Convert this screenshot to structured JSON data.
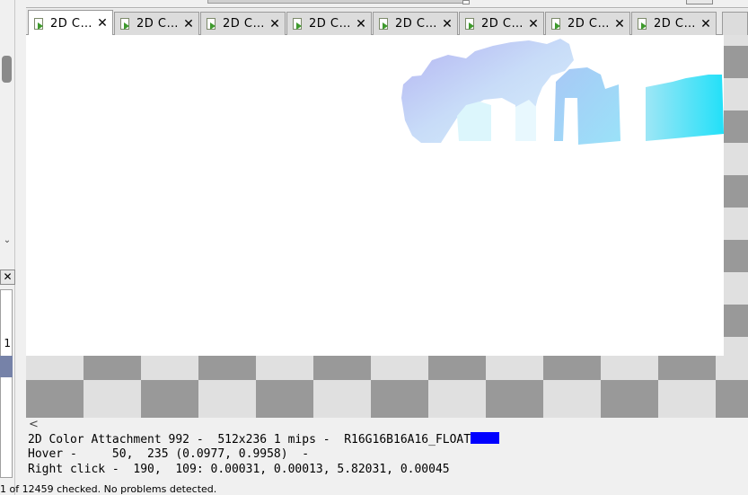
{
  "tabs": [
    {
      "label": "2D C…",
      "active": true
    },
    {
      "label": "2D C…",
      "active": false
    },
    {
      "label": "2D C…",
      "active": false
    },
    {
      "label": "2D C…",
      "active": false
    },
    {
      "label": "2D C…",
      "active": false
    },
    {
      "label": "2D C…",
      "active": false
    },
    {
      "label": "2D C…",
      "active": false
    },
    {
      "label": "2D C…",
      "active": false
    }
  ],
  "tab_close_glyph": "✕",
  "left_panel": {
    "close_glyph": "✕",
    "list_value": "1"
  },
  "info": {
    "line1": "2D Color Attachment 992 -  512x236 1 mips -  R16G16B16A16_FLOAT",
    "line2": "Hover -     50,  235 (0.0977, 0.9958)  -",
    "line3": "Right click -  190,  109: 0.00031, 0.00013, 5.82031, 0.00045",
    "swatch_color": "#0000ff"
  },
  "status_bar": {
    "text": "1 of 12459 checked. No problems detected."
  },
  "colors": {
    "checker_light": "#e0e0e0",
    "checker_dark": "#999999",
    "selection": "#7682a8"
  },
  "icons": {
    "tab_icon": "texture-page-arrow-icon",
    "close": "close-icon",
    "scroll_left": "chevron-left-icon",
    "scroll_down": "chevron-down-icon"
  }
}
